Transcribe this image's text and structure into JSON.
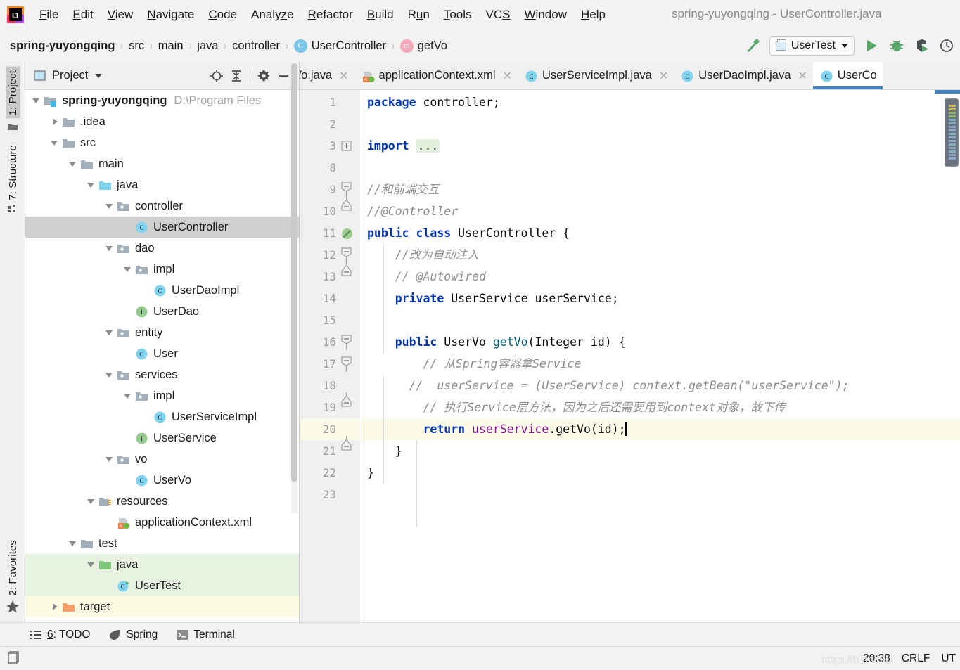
{
  "window": {
    "title": "spring-yuyongqing - UserController.java"
  },
  "menubar": {
    "items": [
      {
        "label": "File",
        "mnemonic": "F"
      },
      {
        "label": "Edit",
        "mnemonic": "E"
      },
      {
        "label": "View",
        "mnemonic": "V"
      },
      {
        "label": "Navigate",
        "mnemonic": "N"
      },
      {
        "label": "Code",
        "mnemonic": "C"
      },
      {
        "label": "Analyze",
        "mnemonic": "z"
      },
      {
        "label": "Refactor",
        "mnemonic": "R"
      },
      {
        "label": "Build",
        "mnemonic": "B"
      },
      {
        "label": "Run",
        "mnemonic": "u"
      },
      {
        "label": "Tools",
        "mnemonic": "T"
      },
      {
        "label": "VCS",
        "mnemonic": "S"
      },
      {
        "label": "Window",
        "mnemonic": "W"
      },
      {
        "label": "Help",
        "mnemonic": "H"
      }
    ]
  },
  "breadcrumb": {
    "items": [
      {
        "label": "spring-yuyongqing",
        "icon": "none",
        "bold": true
      },
      {
        "label": "src",
        "icon": "none",
        "bold": false
      },
      {
        "label": "main",
        "icon": "none",
        "bold": false
      },
      {
        "label": "java",
        "icon": "none",
        "bold": false
      },
      {
        "label": "controller",
        "icon": "none",
        "bold": false
      },
      {
        "label": "UserController",
        "icon": "class-badge",
        "bold": false
      },
      {
        "label": "getVo",
        "icon": "method-badge",
        "bold": false
      }
    ]
  },
  "toolbar": {
    "build_icon": "hammer-icon",
    "run_config": "UserTest",
    "run_icon": "run-icon",
    "debug_icon": "debug-icon",
    "coverage_icon": "run-with-coverage-icon",
    "profile_icon": "profiler-icon"
  },
  "stripes": {
    "project": "1: Project",
    "structure": "7: Structure",
    "favorites": "2: Favorites"
  },
  "project_panel": {
    "title": "Project",
    "actions": [
      "locate-icon",
      "collapse-all-icon",
      "settings-gear-icon",
      "hide-icon"
    ],
    "tree": [
      {
        "label": "spring-yuyongqing",
        "path": "D:\\Program Files",
        "indent": 0,
        "arrow": "open",
        "icon": "module",
        "bold": true,
        "state": "none"
      },
      {
        "label": ".idea",
        "path": "",
        "indent": 1,
        "arrow": "closed",
        "icon": "folder-gray",
        "bold": false,
        "state": "none"
      },
      {
        "label": "src",
        "path": "",
        "indent": 1,
        "arrow": "open",
        "icon": "folder-gray",
        "bold": false,
        "state": "none"
      },
      {
        "label": "main",
        "path": "",
        "indent": 2,
        "arrow": "open",
        "icon": "folder-gray",
        "bold": false,
        "state": "none"
      },
      {
        "label": "java",
        "path": "",
        "indent": 3,
        "arrow": "open",
        "icon": "folder-blue",
        "bold": false,
        "state": "none"
      },
      {
        "label": "controller",
        "path": "",
        "indent": 4,
        "arrow": "open",
        "icon": "package",
        "bold": false,
        "state": "none"
      },
      {
        "label": "UserController",
        "path": "",
        "indent": 5,
        "arrow": "none",
        "icon": "class",
        "bold": false,
        "state": "selected"
      },
      {
        "label": "dao",
        "path": "",
        "indent": 4,
        "arrow": "open",
        "icon": "package",
        "bold": false,
        "state": "none"
      },
      {
        "label": "impl",
        "path": "",
        "indent": 5,
        "arrow": "open",
        "icon": "package",
        "bold": false,
        "state": "none"
      },
      {
        "label": "UserDaoImpl",
        "path": "",
        "indent": 6,
        "arrow": "none",
        "icon": "class",
        "bold": false,
        "state": "none"
      },
      {
        "label": "UserDao",
        "path": "",
        "indent": 5,
        "arrow": "none",
        "icon": "interface",
        "bold": false,
        "state": "none"
      },
      {
        "label": "entity",
        "path": "",
        "indent": 4,
        "arrow": "open",
        "icon": "package",
        "bold": false,
        "state": "none"
      },
      {
        "label": "User",
        "path": "",
        "indent": 5,
        "arrow": "none",
        "icon": "class",
        "bold": false,
        "state": "none"
      },
      {
        "label": "services",
        "path": "",
        "indent": 4,
        "arrow": "open",
        "icon": "package",
        "bold": false,
        "state": "none"
      },
      {
        "label": "impl",
        "path": "",
        "indent": 5,
        "arrow": "open",
        "icon": "package",
        "bold": false,
        "state": "none"
      },
      {
        "label": "UserServiceImpl",
        "path": "",
        "indent": 6,
        "arrow": "none",
        "icon": "class",
        "bold": false,
        "state": "none"
      },
      {
        "label": "UserService",
        "path": "",
        "indent": 5,
        "arrow": "none",
        "icon": "interface",
        "bold": false,
        "state": "none"
      },
      {
        "label": "vo",
        "path": "",
        "indent": 4,
        "arrow": "open",
        "icon": "package",
        "bold": false,
        "state": "none"
      },
      {
        "label": "UserVo",
        "path": "",
        "indent": 5,
        "arrow": "none",
        "icon": "class",
        "bold": false,
        "state": "none"
      },
      {
        "label": "resources",
        "path": "",
        "indent": 3,
        "arrow": "open",
        "icon": "resources",
        "bold": false,
        "state": "none"
      },
      {
        "label": "applicationContext.xml",
        "path": "",
        "indent": 4,
        "arrow": "none",
        "icon": "spring-xml",
        "bold": false,
        "state": "none"
      },
      {
        "label": "test",
        "path": "",
        "indent": 2,
        "arrow": "open",
        "icon": "folder-gray",
        "bold": false,
        "state": "none"
      },
      {
        "label": "java",
        "path": "",
        "indent": 3,
        "arrow": "open",
        "icon": "folder-green",
        "bold": false,
        "state": "green"
      },
      {
        "label": "UserTest",
        "path": "",
        "indent": 4,
        "arrow": "none",
        "icon": "test-class",
        "bold": false,
        "state": "green"
      },
      {
        "label": "target",
        "path": "",
        "indent": 1,
        "arrow": "closed",
        "icon": "folder-orange",
        "bold": false,
        "state": "yellow"
      }
    ]
  },
  "editor_tabs": [
    {
      "label": "Vo.java",
      "icon": "class",
      "active": false,
      "truncated_left": true
    },
    {
      "label": "applicationContext.xml",
      "icon": "spring-xml",
      "active": false,
      "truncated_left": false
    },
    {
      "label": "UserServiceImpl.java",
      "icon": "class",
      "active": false,
      "truncated_left": false
    },
    {
      "label": "UserDaoImpl.java",
      "icon": "class",
      "active": false,
      "truncated_left": false
    },
    {
      "label": "UserCo",
      "icon": "class",
      "active": true,
      "truncated_left": false
    }
  ],
  "editor": {
    "file": "UserController.java",
    "caret_line": 20,
    "lines": [
      {
        "num": "1",
        "fold": "none",
        "gutter_mark": "none",
        "highlight": false
      },
      {
        "num": "2",
        "fold": "none",
        "gutter_mark": "none",
        "highlight": false
      },
      {
        "num": "3",
        "fold": "plus",
        "gutter_mark": "none",
        "highlight": false
      },
      {
        "num": "8",
        "fold": "none",
        "gutter_mark": "none",
        "highlight": false
      },
      {
        "num": "9",
        "fold": "minus-top",
        "gutter_mark": "none",
        "highlight": false
      },
      {
        "num": "10",
        "fold": "minus-bottom",
        "gutter_mark": "none",
        "highlight": false
      },
      {
        "num": "11",
        "fold": "none",
        "gutter_mark": "no-entry-green",
        "highlight": false
      },
      {
        "num": "12",
        "fold": "minus-top",
        "gutter_mark": "none",
        "highlight": false
      },
      {
        "num": "13",
        "fold": "minus-bottom",
        "gutter_mark": "none",
        "highlight": false
      },
      {
        "num": "14",
        "fold": "none",
        "gutter_mark": "none",
        "highlight": false
      },
      {
        "num": "15",
        "fold": "none",
        "gutter_mark": "none",
        "highlight": false
      },
      {
        "num": "16",
        "fold": "minus-top",
        "gutter_mark": "none",
        "highlight": false
      },
      {
        "num": "17",
        "fold": "minus-top",
        "gutter_mark": "none",
        "highlight": false
      },
      {
        "num": "18",
        "fold": "none",
        "gutter_mark": "none",
        "highlight": false
      },
      {
        "num": "19",
        "fold": "minus-bottom",
        "gutter_mark": "none",
        "highlight": false
      },
      {
        "num": "20",
        "fold": "none",
        "gutter_mark": "none",
        "highlight": true
      },
      {
        "num": "21",
        "fold": "minus-bottom",
        "gutter_mark": "none",
        "highlight": false
      },
      {
        "num": "22",
        "fold": "none",
        "gutter_mark": "none",
        "highlight": false
      },
      {
        "num": "23",
        "fold": "none",
        "gutter_mark": "none",
        "highlight": false
      }
    ],
    "code_text": [
      "package controller;",
      "",
      "import ...",
      "",
      "//和前端交互",
      "//@Controller",
      "public class UserController {",
      "    //改为自动注入",
      "    // @Autowired",
      "    private UserService userService;",
      "",
      "    public UserVo getVo(Integer id) {",
      "        // 从Spring容器拿Service",
      "      //  userService = (UserService) context.getBean(\"userService\");",
      "        // 执行Service层方法，因为之后还需要用到context对象，故下传",
      "        return userService.getVo(id);",
      "    }",
      "}",
      ""
    ]
  },
  "bottom_tools": [
    {
      "label": "6: TODO",
      "icon": "todo-icon",
      "mnemonic": "6"
    },
    {
      "label": "Spring",
      "icon": "spring-leaf-icon",
      "mnemonic": ""
    },
    {
      "label": "Terminal",
      "icon": "terminal-icon",
      "mnemonic": ""
    }
  ],
  "statusbar": {
    "left_icon": "toggle-toolwindows-icon",
    "time": "20:38",
    "line_separator": "CRLF",
    "encoding": "UT",
    "watermark": "https://b        dn          d  U"
  },
  "colors": {
    "accent_blue": "#4383c4",
    "selection_gray": "#d0d0d0",
    "green_row": "#e7f3e0",
    "yellow_row": "#fcfbe3",
    "caret_line": "#fcfbe8",
    "keyword": "#0033b3",
    "comment": "#8c8c8c",
    "string": "#067d17",
    "method": "#00627a",
    "field": "#871094"
  }
}
